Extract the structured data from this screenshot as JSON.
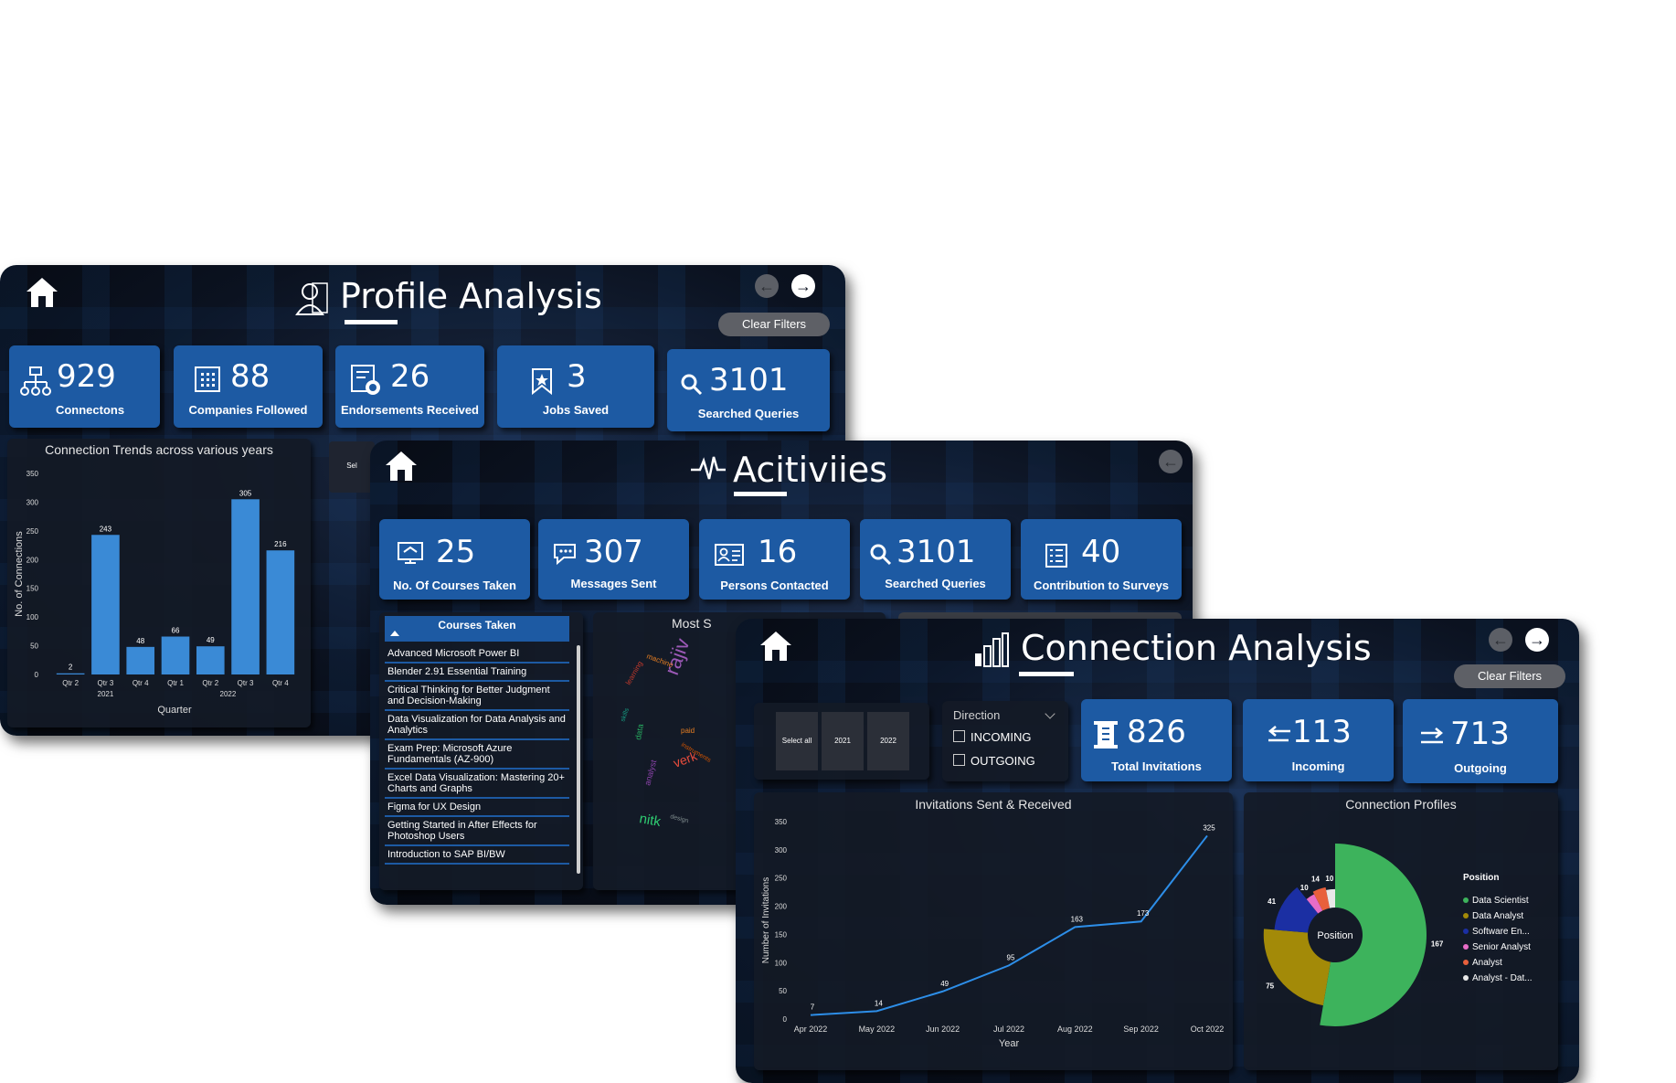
{
  "profile": {
    "title": "Profile Analysis",
    "clear_filters": "Clear Filters",
    "kpis": [
      {
        "value": "929",
        "label": "Connectons",
        "icon": "network-icon"
      },
      {
        "value": "88",
        "label": "Companies Followed",
        "icon": "building-icon"
      },
      {
        "value": "26",
        "label": "Endorsements Received",
        "icon": "endorsement-icon"
      },
      {
        "value": "3",
        "label": "Jobs Saved",
        "icon": "bookmark-star-icon"
      },
      {
        "value": "3101",
        "label": "Searched Queries",
        "icon": "search-icon"
      }
    ],
    "chart_title": "Connection Trends across various years",
    "partial_slicer_text": "Sel"
  },
  "activities": {
    "title": "Acitiviies",
    "kpis": [
      {
        "value": "25",
        "label": "No. Of Courses Taken",
        "icon": "course-icon"
      },
      {
        "value": "307",
        "label": "Messages Sent",
        "icon": "chat-icon"
      },
      {
        "value": "16",
        "label": "Persons Contacted",
        "icon": "contact-card-icon"
      },
      {
        "value": "3101",
        "label": "Searched Queries",
        "icon": "search-icon"
      },
      {
        "value": "40",
        "label": "Contribution to Surveys",
        "icon": "survey-icon"
      }
    ],
    "courses_header": "Courses Taken",
    "courses": [
      "Advanced Microsoft Power BI",
      "Blender 2.91 Essential Training",
      "Critical Thinking for Better Judgment and Decision-Making",
      "Data Visualization for Data Analysis and Analytics",
      "Exam Prep: Microsoft Azure Fundamentals (AZ-900)",
      "Excel Data Visualization: Mastering 20+ Charts and Graphs",
      "Figma for UX Design",
      "Getting Started in After Effects for Photoshop Users",
      "Introduction to SAP BI/BW"
    ],
    "wordcloud_title_partial": "Most S",
    "wordcloud_words": [
      "rajiv",
      "machine",
      "learning",
      "verk",
      "nitk",
      "paid",
      "instruments",
      "data",
      "analyst",
      "design",
      "skills"
    ]
  },
  "connection": {
    "title": "Connection Analysis",
    "clear_filters": "Clear Filters",
    "year_slicer": [
      "Select all",
      "2021",
      "2022"
    ],
    "direction": {
      "label": "Direction",
      "options": [
        "INCOMING",
        "OUTGOING"
      ]
    },
    "kpis": [
      {
        "value": "826",
        "label": "Total Invitations",
        "icon": "invitation-icon"
      },
      {
        "value": "113",
        "label": "Incoming",
        "icon": "incoming-arrows-icon"
      },
      {
        "value": "713",
        "label": "Outgoing",
        "icon": "outgoing-arrows-icon"
      }
    ],
    "legend_title": "Position",
    "legend": [
      {
        "name": "Data Scientist",
        "color": "#3db35c"
      },
      {
        "name": "Data Analyst",
        "color": "#a38a08"
      },
      {
        "name": "Software En...",
        "color": "#1b2fa3"
      },
      {
        "name": "Senior Analyst",
        "color": "#e86cc7"
      },
      {
        "name": "Analyst",
        "color": "#e8603c"
      },
      {
        "name": "Analyst - Dat...",
        "color": "#e8e8e8"
      }
    ]
  },
  "chart_data": [
    {
      "type": "bar",
      "title": "Connection Trends across various years",
      "xlabel": "Quarter",
      "ylabel": "No. of Connections",
      "ylim": [
        0,
        350
      ],
      "yticks": [
        0,
        50,
        100,
        150,
        200,
        250,
        300,
        350
      ],
      "categories": [
        "Qtr 2",
        "Qtr 3",
        "Qtr 4",
        "Qtr 1",
        "Qtr 2",
        "Qtr 3",
        "Qtr 4"
      ],
      "groups": [
        {
          "label": "2021",
          "span": [
            0,
            2
          ]
        },
        {
          "label": "2022",
          "span": [
            3,
            6
          ]
        }
      ],
      "values": [
        2,
        243,
        48,
        66,
        49,
        305,
        216
      ],
      "color": "#3a8ad6"
    },
    {
      "type": "line",
      "title": "Invitations Sent & Received",
      "xlabel": "Year",
      "ylabel": "Number of Invitations",
      "ylim": [
        0,
        350
      ],
      "yticks": [
        0,
        50,
        100,
        150,
        200,
        250,
        300,
        350
      ],
      "x": [
        "Apr 2022",
        "May 2022",
        "Jun 2022",
        "Jul 2022",
        "Aug 2022",
        "Sep 2022",
        "Oct 2022"
      ],
      "values": [
        7,
        14,
        49,
        95,
        163,
        173,
        325
      ],
      "color": "#2d8ee8"
    },
    {
      "type": "pie",
      "title": "Connection Profiles",
      "center_label": "Position",
      "slices": [
        {
          "name": "Data Scientist",
          "value": 167,
          "color": "#3db35c"
        },
        {
          "name": "Data Analyst",
          "value": 75,
          "color": "#a38a08"
        },
        {
          "name": "Software En...",
          "value": 41,
          "color": "#1b2fa3"
        },
        {
          "name": "Senior Analyst",
          "value": 10,
          "color": "#e86cc7"
        },
        {
          "name": "Analyst",
          "value": 14,
          "color": "#e8603c"
        },
        {
          "name": "Analyst - Dat...",
          "value": 10,
          "color": "#e8e8e8"
        }
      ]
    }
  ]
}
